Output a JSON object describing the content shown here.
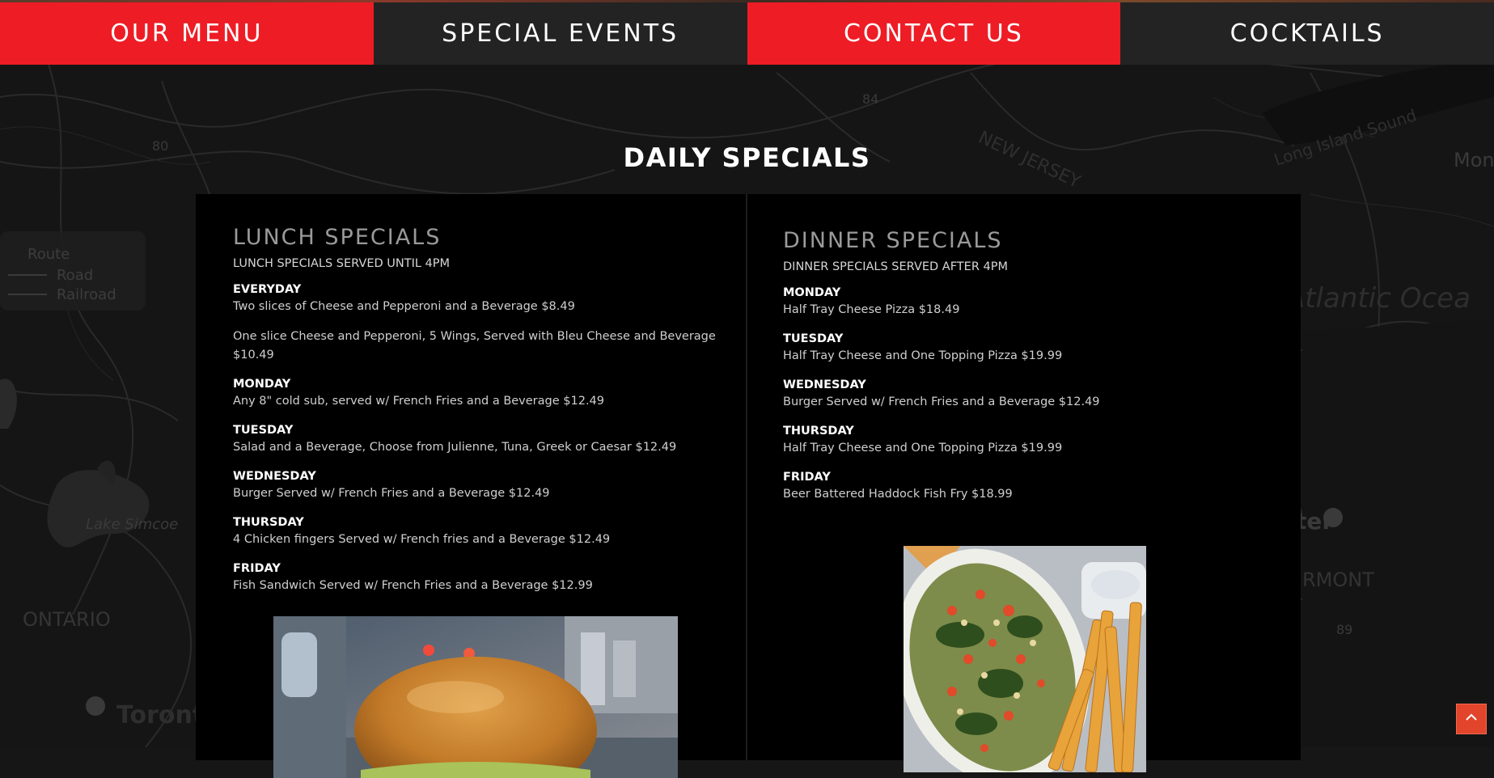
{
  "nav": {
    "items": [
      {
        "label": "OUR MENU"
      },
      {
        "label": "SPECIAL EVENTS"
      },
      {
        "label": "CONTACT US"
      },
      {
        "label": "COCKTAILS"
      }
    ]
  },
  "page_title": "DAILY SPECIALS",
  "lunch": {
    "title": "LUNCH SPECIALS",
    "subtitle": "LUNCH SPECIALS SERVED UNTIL 4PM",
    "everyday": {
      "name": "EVERYDAY",
      "desc": "Two slices of Cheese and Pepperoni and a Beverage $8.49",
      "desc2": "One slice Cheese and Pepperoni, 5 Wings, Served with Bleu Cheese and Beverage $10.49"
    },
    "days": [
      {
        "name": "MONDAY",
        "desc": "Any 8\" cold sub, served w/ French Fries and a Beverage $12.49"
      },
      {
        "name": "TUESDAY",
        "desc": "Salad and a Beverage, Choose from Julienne, Tuna, Greek or Caesar $12.49"
      },
      {
        "name": "WEDNESDAY",
        "desc": "Burger Served w/ French Fries and a Beverage $12.49"
      },
      {
        "name": "THURSDAY",
        "desc": "4 Chicken fingers Served w/ French fries and a Beverage $12.49"
      },
      {
        "name": "FRIDAY",
        "desc": "Fish Sandwich Served w/ French Fries and a Beverage $12.99"
      }
    ]
  },
  "dinner": {
    "title": "DINNER SPECIALS",
    "subtitle": "DINNER SPECIALS SERVED AFTER 4PM",
    "days": [
      {
        "name": "MONDAY",
        "desc": "Half Tray Cheese Pizza $18.49"
      },
      {
        "name": "TUESDAY",
        "desc": "Half Tray Cheese and One Topping Pizza $19.99"
      },
      {
        "name": "WEDNESDAY",
        "desc": "Burger Served w/ French Fries and a Beverage $12.49"
      },
      {
        "name": "THURSDAY",
        "desc": "Half Tray Cheese and One Topping Pizza $19.99"
      },
      {
        "name": "FRIDAY",
        "desc": "Beer Battered Haddock Fish Fry $18.99"
      }
    ]
  },
  "map_labels": {
    "route_legend": [
      "Route",
      "Road",
      "Railroad"
    ],
    "places": [
      "NEW JERSEY",
      "Long Island Sound",
      "Mon",
      "Atlantic Ocea",
      "Lake Simcoe",
      "ONTARIO",
      "Toront",
      "ter",
      "RMONT",
      "84",
      "80",
      "89"
    ]
  },
  "colors": {
    "accent_red": "#ee1c25",
    "nav_dark": "#232323",
    "panel_bg": "#000000",
    "scroll_button": "#e2452b"
  },
  "icons": {
    "scroll_top": "chevron-up-icon"
  }
}
